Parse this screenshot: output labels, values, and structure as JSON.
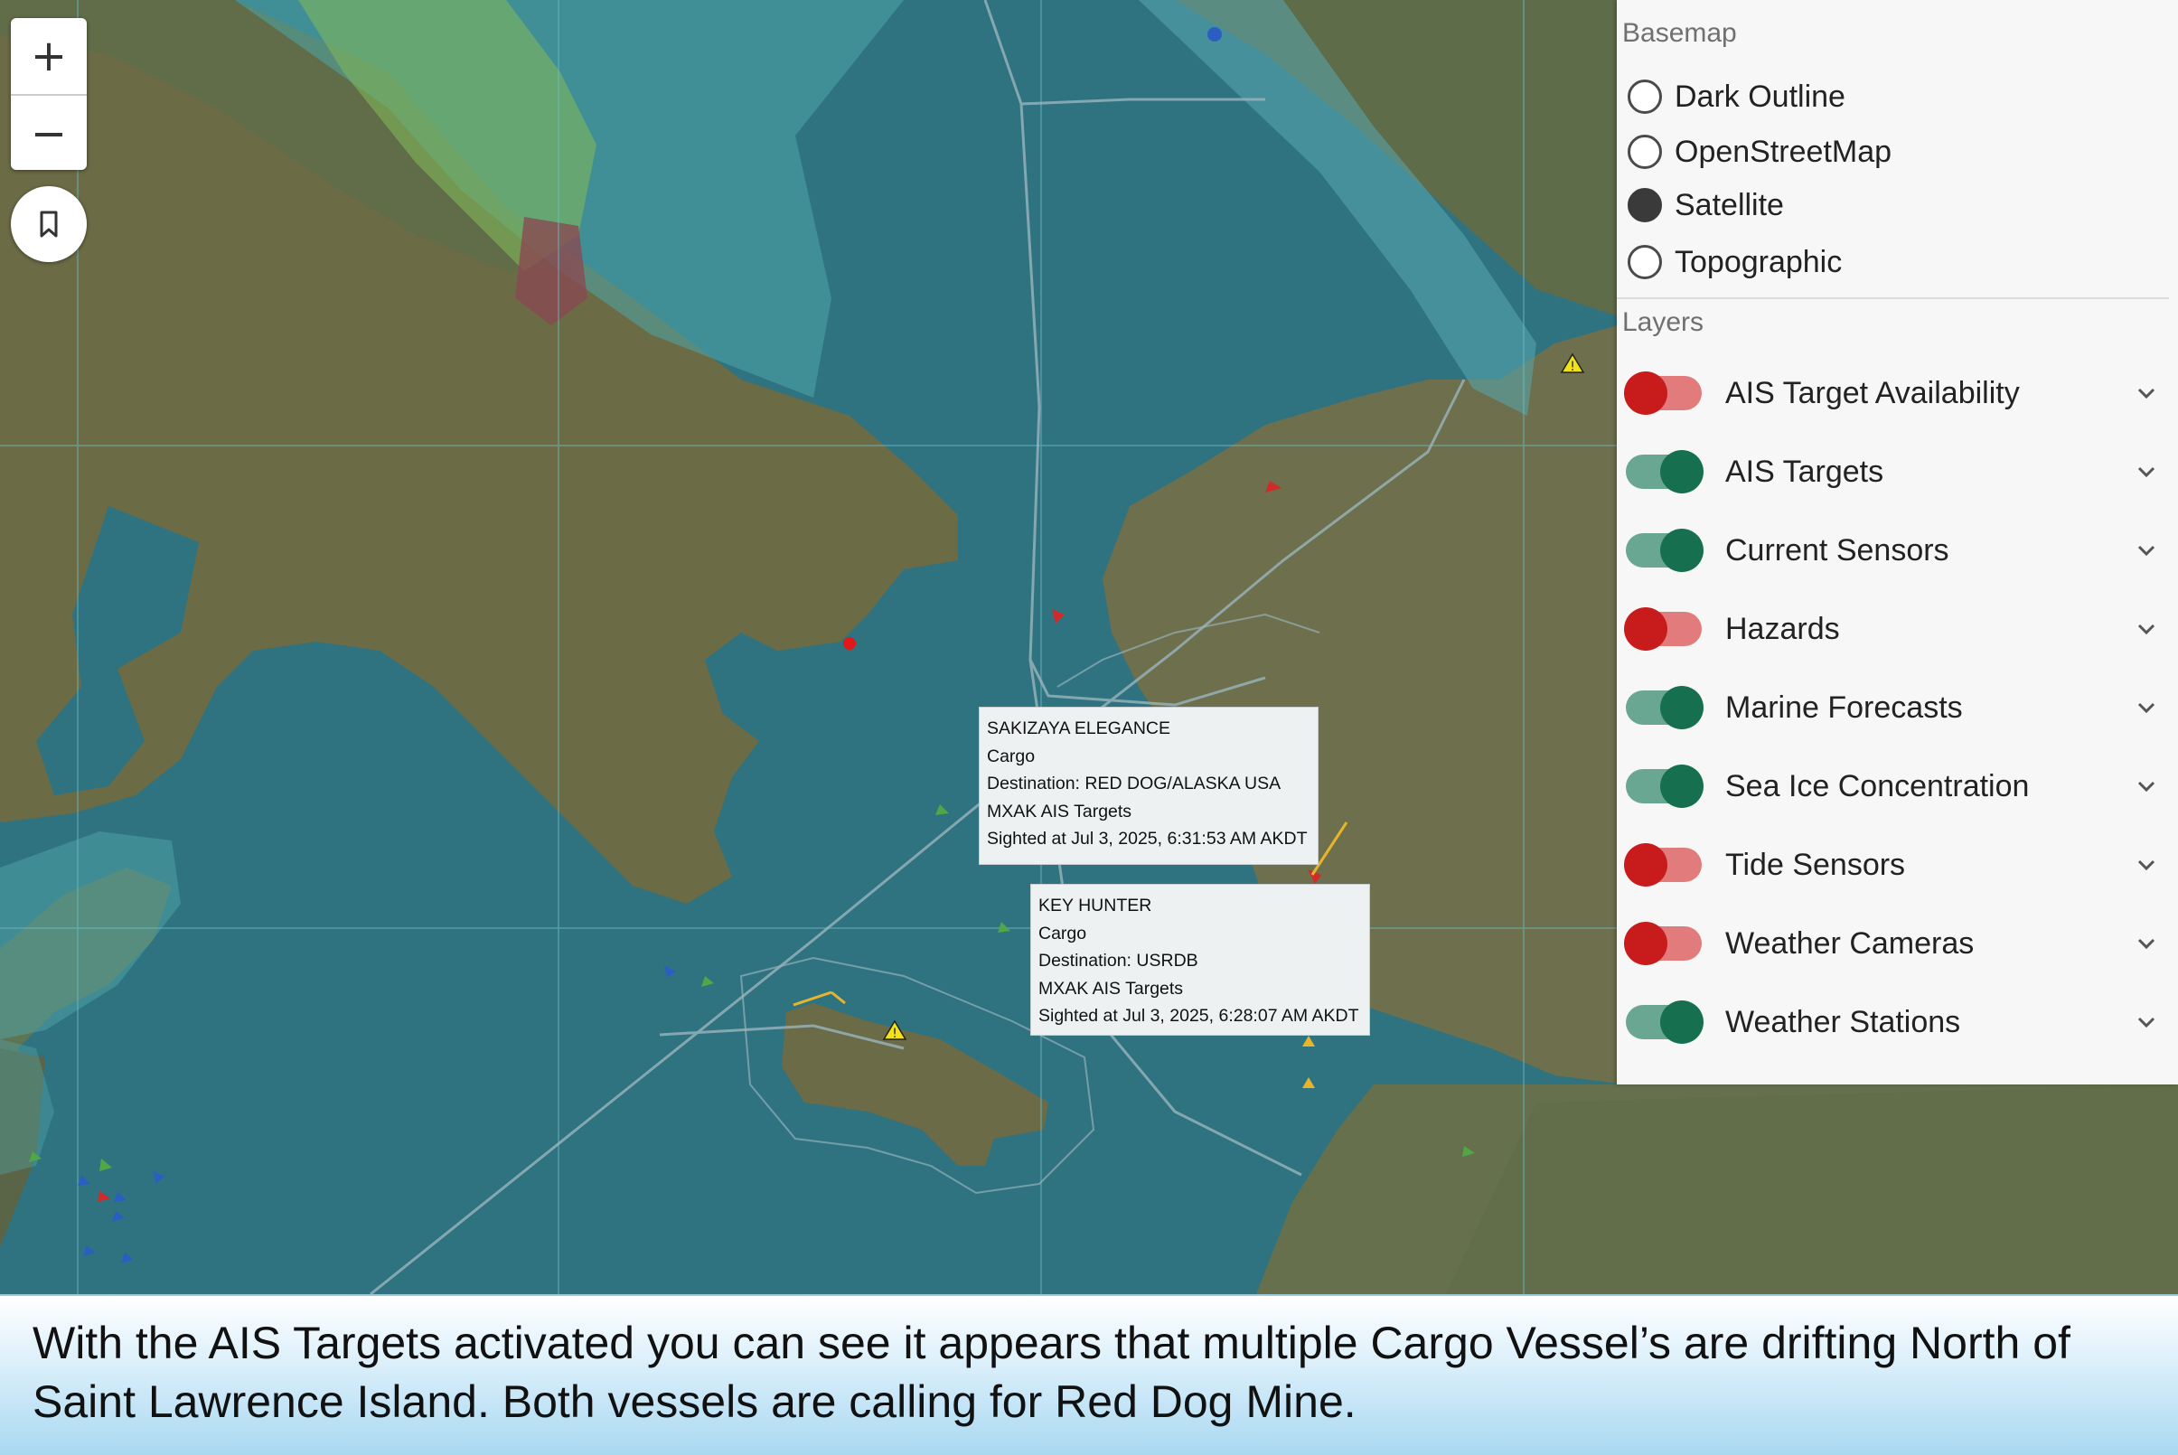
{
  "map_controls": {
    "zoom_in": "+",
    "zoom_out": "−",
    "bookmark_icon": "bookmark-icon"
  },
  "popups": [
    {
      "vessel_name": "SAKIZAYA ELEGANCE",
      "type": "Cargo",
      "destination": "Destination: RED DOG/ALASKA USA",
      "source": "MXAK AIS Targets",
      "sighted": "Sighted at Jul 3, 2025, 6:31:53 AM AKDT"
    },
    {
      "vessel_name": "KEY HUNTER",
      "type": "Cargo",
      "destination": "Destination: USRDB",
      "source": "MXAK AIS Targets",
      "sighted": "Sighted at Jul 3, 2025, 6:28:07 AM AKDT"
    }
  ],
  "panel": {
    "basemap_label": "Basemap",
    "basemaps": [
      {
        "label": "Dark Outline",
        "selected": false
      },
      {
        "label": "OpenStreetMap",
        "selected": false
      },
      {
        "label": "Satellite",
        "selected": true
      },
      {
        "label": "Topographic",
        "selected": false
      }
    ],
    "layers_label": "Layers",
    "layers": [
      {
        "label": "AIS Target Availability",
        "enabled": false
      },
      {
        "label": "AIS Targets",
        "enabled": true
      },
      {
        "label": "Current Sensors",
        "enabled": true
      },
      {
        "label": "Hazards",
        "enabled": false
      },
      {
        "label": "Marine Forecasts",
        "enabled": true
      },
      {
        "label": "Sea Ice Concentration",
        "enabled": true
      },
      {
        "label": "Tide Sensors",
        "enabled": false
      },
      {
        "label": "Weather Cameras",
        "enabled": false
      },
      {
        "label": "Weather Stations",
        "enabled": true
      }
    ],
    "colors": {
      "toggle_on": "#16704f",
      "toggle_off": "#c81c1c"
    }
  },
  "caption": {
    "text": "With the AIS Targets activated you can see it appears that multiple Cargo Vessel’s are drifting North of Saint Lawrence Island. Both vessels are calling for Red Dog Mine."
  }
}
